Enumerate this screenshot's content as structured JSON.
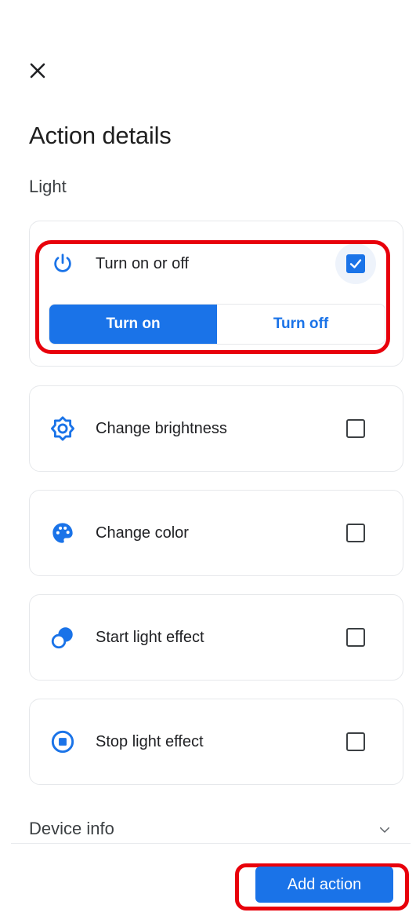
{
  "header": {
    "close_icon": "close-icon",
    "title": "Action details",
    "subtitle": "Light"
  },
  "actions": [
    {
      "label": "Turn on or off",
      "icon": "power-icon",
      "checked": true
    },
    {
      "label": "Change brightness",
      "icon": "brightness-icon",
      "checked": false
    },
    {
      "label": "Change color",
      "icon": "palette-icon",
      "checked": false
    },
    {
      "label": "Start light effect",
      "icon": "light-effect-icon",
      "checked": false
    },
    {
      "label": "Stop light effect",
      "icon": "stop-circle-icon",
      "checked": false
    }
  ],
  "toggle": {
    "on_label": "Turn on",
    "off_label": "Turn off",
    "selected": "Turn on"
  },
  "device_info": {
    "label": "Device info",
    "icon": "chevron-down-icon"
  },
  "footer": {
    "add_action_label": "Add action"
  },
  "colors": {
    "accent": "#1a73e8",
    "highlight": "#e8000b"
  }
}
